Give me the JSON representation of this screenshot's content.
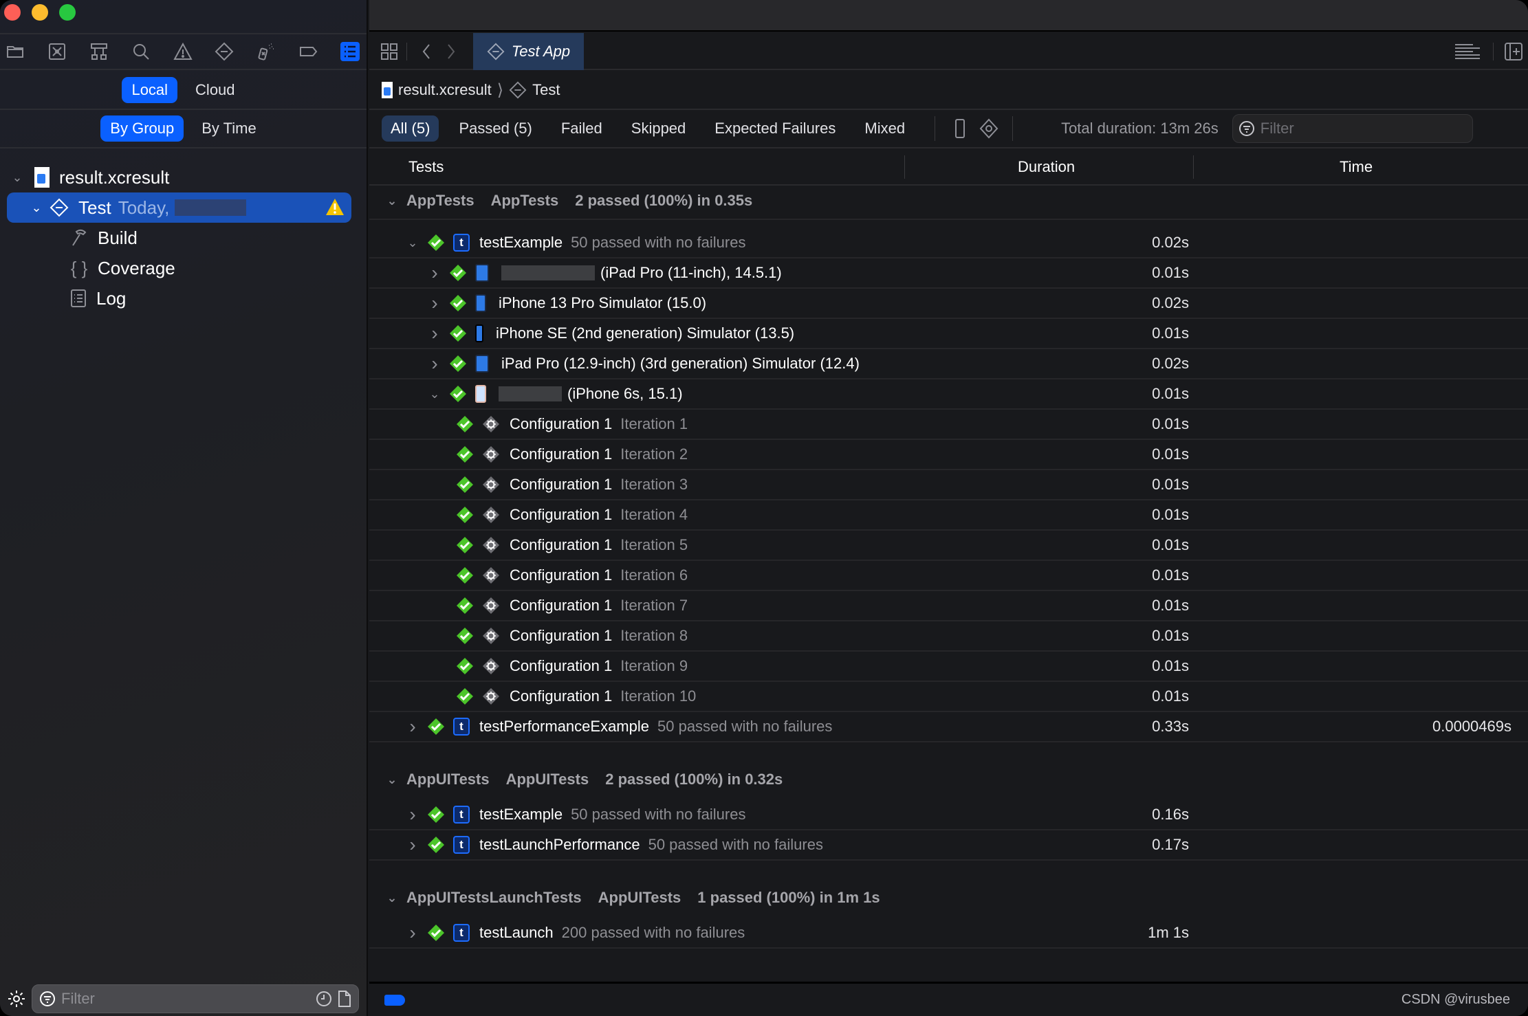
{
  "sidebar": {
    "nav_icons": [
      "folder-icon",
      "source-control-icon",
      "hierarchy-icon",
      "search-icon",
      "warning-icon",
      "test-icon",
      "debug-icon",
      "breakpoint-icon",
      "report-icon"
    ],
    "source_tabs": [
      {
        "label": "Local",
        "active": true
      },
      {
        "label": "Cloud",
        "active": false
      }
    ],
    "group_tabs": [
      {
        "label": "By Group",
        "active": true
      },
      {
        "label": "By Time",
        "active": false
      }
    ],
    "tree": {
      "root": "result.xcresult",
      "selected": {
        "label": "Test",
        "sublabel": "Today,"
      },
      "children": [
        "Build",
        "Coverage",
        "Log"
      ]
    },
    "filter_placeholder": "Filter"
  },
  "tabbar": {
    "tab_label": "Test App"
  },
  "breadcrumb": {
    "file": "result.xcresult",
    "item": "Test"
  },
  "filterbar": {
    "buttons": [
      {
        "label": "All (5)",
        "active": true
      },
      {
        "label": "Passed (5)",
        "active": false
      },
      {
        "label": "Failed",
        "active": false
      },
      {
        "label": "Skipped",
        "active": false
      },
      {
        "label": "Expected Failures",
        "active": false
      },
      {
        "label": "Mixed",
        "active": false
      }
    ],
    "total_duration": "Total duration: 13m 26s",
    "filter_placeholder": "Filter"
  },
  "columns": {
    "tests": "Tests",
    "duration": "Duration",
    "time": "Time"
  },
  "groups": [
    {
      "name": "AppTests",
      "target": "AppTests",
      "summary": "2 passed (100%) in 0.35s",
      "tests": [
        {
          "name": "testExample",
          "summary": "50 passed with no failures",
          "duration": "0.02s",
          "time": "",
          "expanded": true,
          "devices": [
            {
              "label": "(iPad Pro (11-inch), 14.5.1)",
              "duration": "0.01s",
              "redacted": true
            },
            {
              "label": "iPhone 13 Pro Simulator (15.0)",
              "duration": "0.02s",
              "redacted": false
            },
            {
              "label": "iPhone SE (2nd generation) Simulator (13.5)",
              "duration": "0.01s",
              "redacted": false
            },
            {
              "label": "iPad Pro (12.9-inch) (3rd generation) Simulator (12.4)",
              "duration": "0.02s",
              "redacted": false
            },
            {
              "label": "(iPhone 6s, 15.1)",
              "duration": "0.01s",
              "redacted": true,
              "expanded": true
            }
          ],
          "iterations": [
            {
              "config": "Configuration 1",
              "iteration": "Iteration 1",
              "duration": "0.01s"
            },
            {
              "config": "Configuration 1",
              "iteration": "Iteration 2",
              "duration": "0.01s"
            },
            {
              "config": "Configuration 1",
              "iteration": "Iteration 3",
              "duration": "0.01s"
            },
            {
              "config": "Configuration 1",
              "iteration": "Iteration 4",
              "duration": "0.01s"
            },
            {
              "config": "Configuration 1",
              "iteration": "Iteration 5",
              "duration": "0.01s"
            },
            {
              "config": "Configuration 1",
              "iteration": "Iteration 6",
              "duration": "0.01s"
            },
            {
              "config": "Configuration 1",
              "iteration": "Iteration 7",
              "duration": "0.01s"
            },
            {
              "config": "Configuration 1",
              "iteration": "Iteration 8",
              "duration": "0.01s"
            },
            {
              "config": "Configuration 1",
              "iteration": "Iteration 9",
              "duration": "0.01s"
            },
            {
              "config": "Configuration 1",
              "iteration": "Iteration 10",
              "duration": "0.01s"
            }
          ]
        },
        {
          "name": "testPerformanceExample",
          "summary": "50 passed with no failures",
          "duration": "0.33s",
          "time": "0.0000469s"
        }
      ]
    },
    {
      "name": "AppUITests",
      "target": "AppUITests",
      "summary": "2 passed (100%) in 0.32s",
      "tests": [
        {
          "name": "testExample",
          "summary": "50 passed with no failures",
          "duration": "0.16s",
          "time": ""
        },
        {
          "name": "testLaunchPerformance",
          "summary": "50 passed with no failures",
          "duration": "0.17s",
          "time": ""
        }
      ]
    },
    {
      "name": "AppUITestsLaunchTests",
      "target": "AppUITests",
      "summary": "1 passed (100%) in 1m 1s",
      "tests": [
        {
          "name": "testLaunch",
          "summary": "200 passed with no failures",
          "duration": "1m 1s",
          "time": ""
        }
      ]
    }
  ],
  "watermark": "CSDN @virusbee",
  "colors": {
    "accent": "#0a60ff",
    "selected_row": "#1a52b8",
    "pass_green": "#4cc52a",
    "warning_yellow": "#f5c400",
    "tab_active": "#253a5b"
  }
}
